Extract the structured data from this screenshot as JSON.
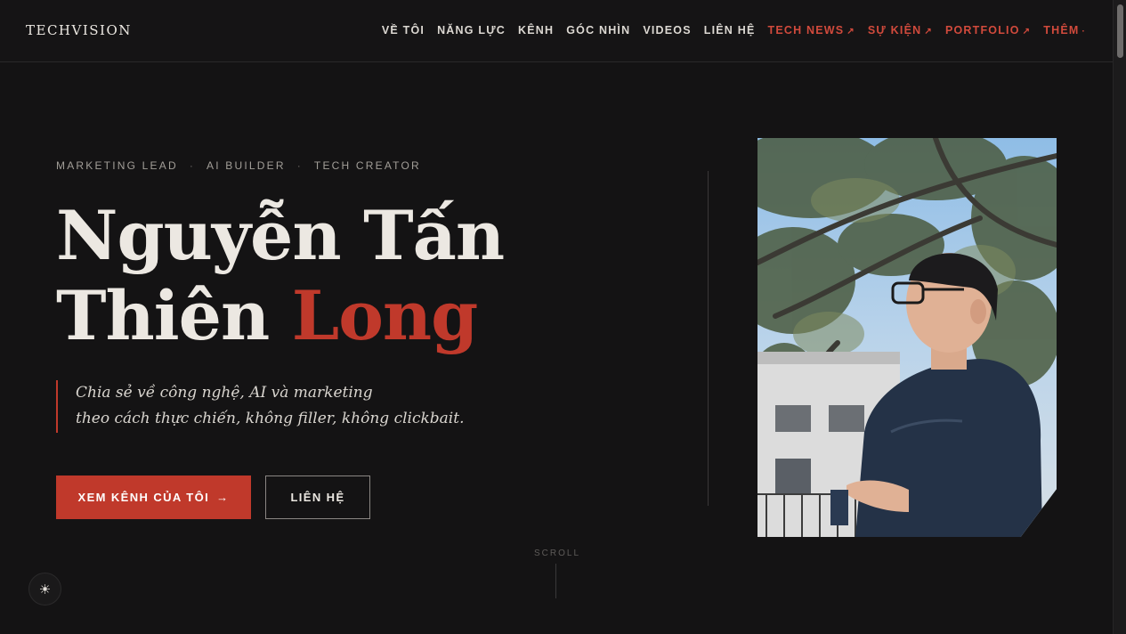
{
  "header": {
    "logo": "TECHVISION",
    "nav": [
      {
        "label": "VỀ TÔI"
      },
      {
        "label": "NĂNG LỰC"
      },
      {
        "label": "KÊNH"
      },
      {
        "label": "GÓC NHÌN"
      },
      {
        "label": "VIDEOS"
      },
      {
        "label": "LIÊN HỆ"
      }
    ],
    "nav_external": [
      {
        "label": "TECH NEWS",
        "arrow": "↗"
      },
      {
        "label": "SỰ KIỆN",
        "arrow": "↗"
      },
      {
        "label": "PORTFOLIO",
        "arrow": "↗"
      },
      {
        "label": "THÊM",
        "arrow": "·"
      }
    ]
  },
  "hero": {
    "roles": [
      "MARKETING LEAD",
      "AI BUILDER",
      "TECH CREATOR"
    ],
    "separator": "·",
    "name_line1": "Nguyễn Tấn",
    "name_line2": "Thiên",
    "name_accent": "Long",
    "tagline_line1": "Chia sẻ về công nghệ, AI và marketing",
    "tagline_line2": "theo cách thực chiến, không filler, không clickbait.",
    "primary_button": "XEM KÊNH CỦA TÔI",
    "primary_button_arrow": "→",
    "secondary_button": "LIÊN HỆ"
  },
  "scroll_label": "SCROLL",
  "theme_toggle_icon": "☀",
  "colors": {
    "background": "#141314",
    "accent": "#c0392b",
    "text": "#ece8e2"
  }
}
